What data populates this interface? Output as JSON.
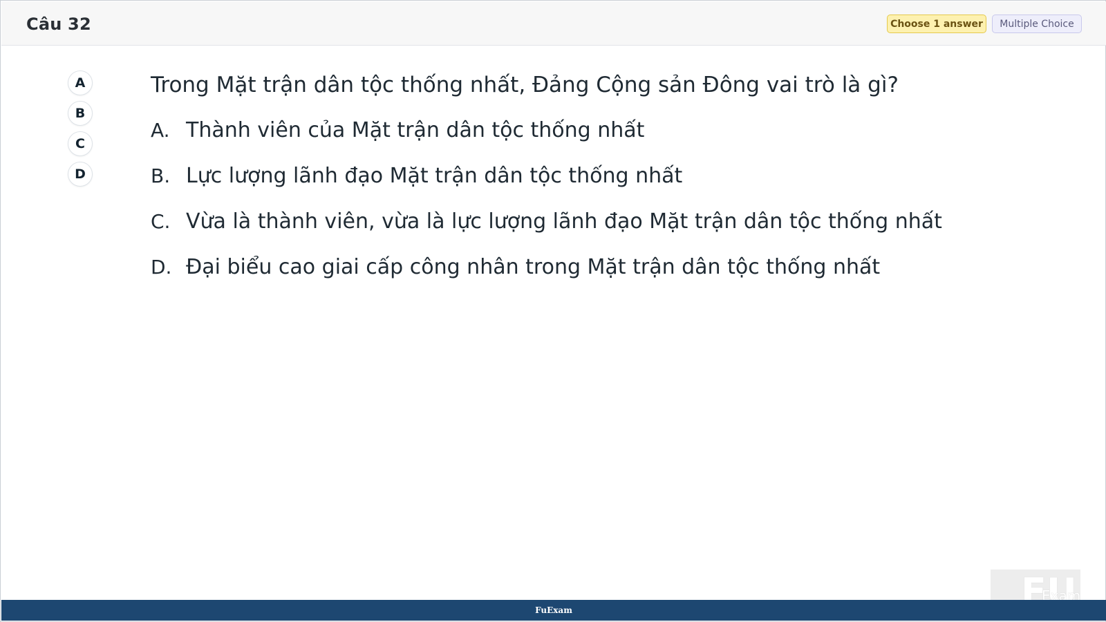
{
  "header": {
    "question_number": "Câu 32",
    "choose_badge": "Choose 1 answer",
    "type_badge": "Multiple Choice"
  },
  "answer_buttons": [
    "A",
    "B",
    "C",
    "D"
  ],
  "question": {
    "text": "Trong Mặt trận dân tộc thống nhất, Đảng Cộng sản Đông vai trò là gì?",
    "options": [
      {
        "letter": "A.",
        "text": "Thành viên của Mặt trận dân tộc thống nhất"
      },
      {
        "letter": "B.",
        "text": "Lực lượng lãnh đạo Mặt trận dân tộc thống nhất"
      },
      {
        "letter": "C.",
        "text": "Vừa là thành viên, vừa là lực lượng lãnh đạo Mặt trận dân tộc thống nhất"
      },
      {
        "letter": "D.",
        "text": "Đại biểu cao giai cấp công nhân trong Mặt trận dân tộc thống nhất"
      }
    ]
  },
  "footer": {
    "brand": "FuExam"
  },
  "watermark": {
    "logo": "FU",
    "text": "Exam"
  }
}
